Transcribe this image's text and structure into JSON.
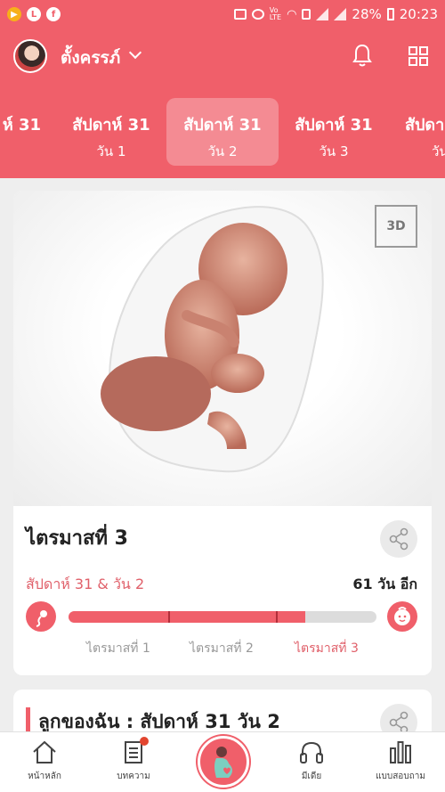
{
  "status_bar": {
    "battery": "28%",
    "time": "20:23"
  },
  "header": {
    "username": "ตั้งครรภ์",
    "tabs": [
      {
        "week": "ห์ 31",
        "day": ""
      },
      {
        "week": "สัปดาห์ 31",
        "day": "วัน 1"
      },
      {
        "week": "สัปดาห์ 31",
        "day": "วัน 2"
      },
      {
        "week": "สัปดาห์ 31",
        "day": "วัน 3"
      },
      {
        "week": "สัปดา",
        "day": "วัน"
      }
    ],
    "active_tab": 2
  },
  "hero": {
    "badge_3d": "3D"
  },
  "progress": {
    "trimester_title": "ไตรมาสที่ 3",
    "week_day": "สัปดาห์ 31 & วัน 2",
    "remaining": "61 วัน อีก",
    "fraction": 0.77,
    "trimesters": [
      "ไตรมาสที่ 1",
      "ไตรมาสที่ 2",
      "ไตรมาสที่ 3"
    ],
    "current_trimester": 3
  },
  "section2": {
    "title": "ลูกของฉัน : สัปดาห์ 31 วัน 2"
  },
  "bottom_nav": [
    {
      "label": "หน้าหลัก",
      "icon": "home-icon"
    },
    {
      "label": "บทความ",
      "icon": "article-icon"
    },
    {
      "label": "",
      "icon": "pregnancy-icon"
    },
    {
      "label": "มีเดีย",
      "icon": "headphones-icon"
    },
    {
      "label": "แบบสอบถาม",
      "icon": "poll-icon"
    }
  ],
  "colors": {
    "primary": "#f05f6a",
    "progress_track": "#dcdcdc",
    "notification_dot": "#e2452f"
  }
}
